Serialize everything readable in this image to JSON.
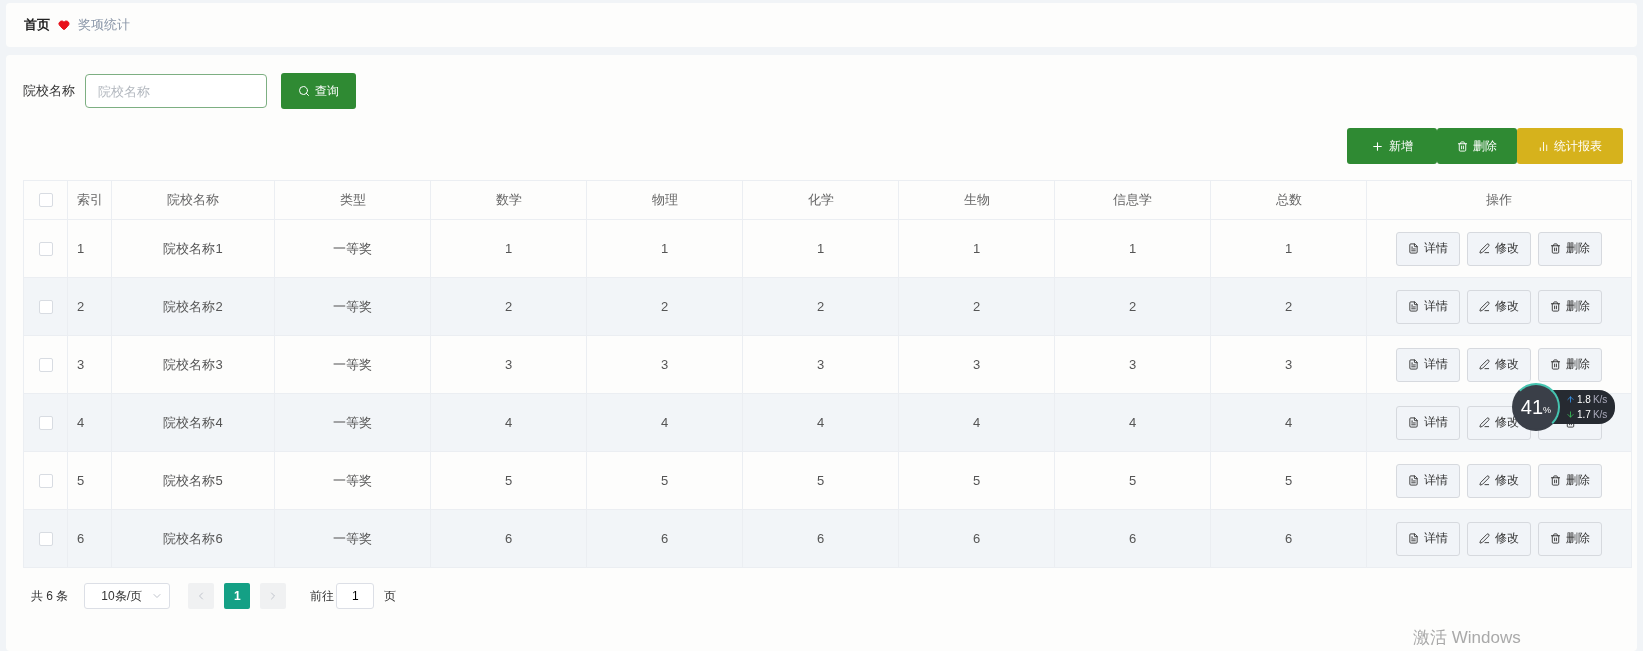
{
  "breadcrumb": [
    {
      "label": "首页",
      "current": false
    },
    {
      "label": "奖项统计",
      "current": true
    }
  ],
  "search": {
    "label": "院校名称",
    "placeholder": "院校名称",
    "button": "查询"
  },
  "toolbar": [
    {
      "kind": "add",
      "label": "新增"
    },
    {
      "kind": "delete",
      "label": "删除"
    },
    {
      "kind": "report",
      "label": "统计报表"
    }
  ],
  "table": {
    "select_all": {
      "checked": false
    },
    "columns": [
      "索引",
      "院校名称",
      "类型",
      "数学",
      "物理",
      "化学",
      "生物",
      "信息学",
      "总数",
      "操作"
    ],
    "rows": [
      {
        "checked": false,
        "cells": [
          "1",
          "院校名称1",
          "一等奖",
          "1",
          "1",
          "1",
          "1",
          "1",
          "1"
        ],
        "actions": [
          {
            "kind": "detail",
            "label": "详情"
          },
          {
            "kind": "edit",
            "label": "修改"
          },
          {
            "kind": "delete",
            "label": "删除"
          }
        ]
      },
      {
        "checked": false,
        "cells": [
          "2",
          "院校名称2",
          "一等奖",
          "2",
          "2",
          "2",
          "2",
          "2",
          "2"
        ],
        "actions": [
          {
            "kind": "detail",
            "label": "详情"
          },
          {
            "kind": "edit",
            "label": "修改"
          },
          {
            "kind": "delete",
            "label": "删除"
          }
        ]
      },
      {
        "checked": false,
        "cells": [
          "3",
          "院校名称3",
          "一等奖",
          "3",
          "3",
          "3",
          "3",
          "3",
          "3"
        ],
        "actions": [
          {
            "kind": "detail",
            "label": "详情"
          },
          {
            "kind": "edit",
            "label": "修改"
          },
          {
            "kind": "delete",
            "label": "删除"
          }
        ]
      },
      {
        "checked": false,
        "cells": [
          "4",
          "院校名称4",
          "一等奖",
          "4",
          "4",
          "4",
          "4",
          "4",
          "4"
        ],
        "actions": [
          {
            "kind": "detail",
            "label": "详情"
          },
          {
            "kind": "edit",
            "label": "修改"
          },
          {
            "kind": "delete"
          }
        ]
      },
      {
        "checked": false,
        "cells": [
          "5",
          "院校名称5",
          "一等奖",
          "5",
          "5",
          "5",
          "5",
          "5",
          "5"
        ],
        "actions": [
          {
            "kind": "detail",
            "label": "详情"
          },
          {
            "kind": "edit",
            "label": "修改"
          },
          {
            "kind": "delete",
            "label": "删除"
          }
        ]
      },
      {
        "checked": false,
        "cells": [
          "6",
          "院校名称6",
          "一等奖",
          "6",
          "6",
          "6",
          "6",
          "6",
          "6"
        ],
        "actions": [
          {
            "kind": "detail",
            "label": "详情"
          },
          {
            "kind": "edit",
            "label": "修改"
          },
          {
            "kind": "delete",
            "label": "删除"
          }
        ]
      }
    ]
  },
  "pagination": {
    "total": "共 6 条",
    "page_size": "10条/页",
    "pages": [
      {
        "label": "1",
        "selected": true
      }
    ],
    "goto_label": "前往",
    "goto_value": "1",
    "goto_suffix": "页"
  },
  "speed_widget": {
    "percent": "41",
    "percent_unit": "%",
    "upload": "1.8",
    "upload_unit": "K/s",
    "download": "1.7",
    "download_unit": "K/s"
  },
  "system_notice": "激活 Windows"
}
